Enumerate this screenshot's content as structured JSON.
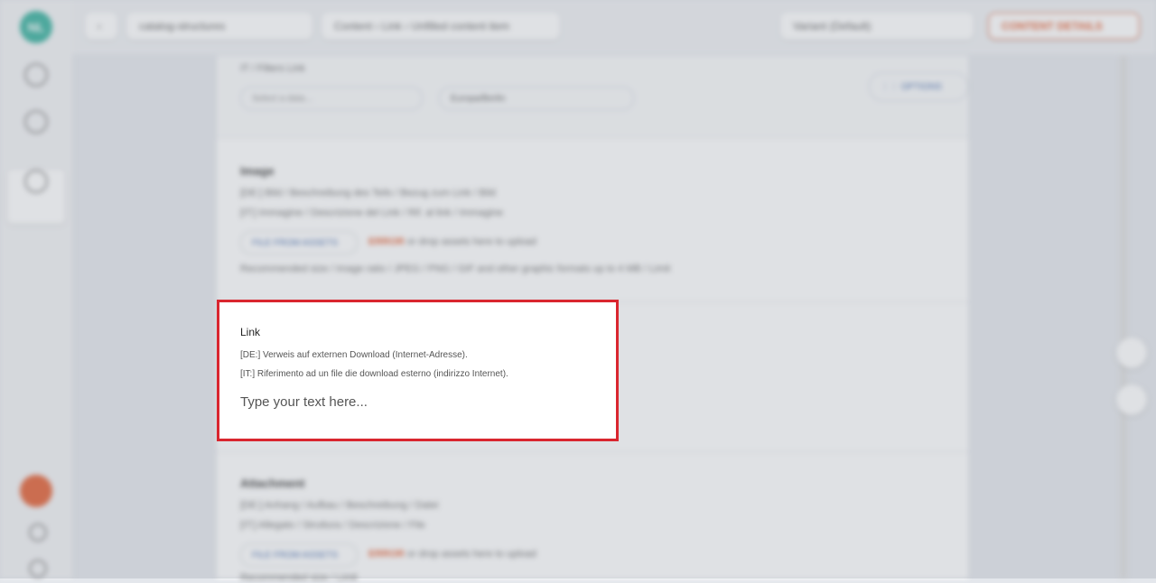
{
  "background": {
    "logo_text": "NL",
    "topbar": {
      "back": "‹",
      "selector": "catalog-structures",
      "breadcrumb": [
        "Content",
        "Link",
        "Unfilled content item"
      ],
      "variant": "Variant (Default)",
      "action": "CONTENT DETAILS"
    },
    "filters": {
      "label": "IT / Filters Link",
      "search_placeholder": "Select a data…",
      "dropdown": "Europa/Berlin",
      "options_btn": "⋮⋮ OPTIONS"
    },
    "image_section": {
      "title": "Image",
      "de": "[DE:] Bild / Beschreibung des Teils / Bezug zum Link / Bild",
      "it": "[IT:] Immagine / Descrizione del Link / Rif. al link / Immagine",
      "chip": "FILE FROM ASSETS",
      "drop": "ERROR",
      "drop_rest": "or drop assets here to upload",
      "hint": "Recommended size / image ratio / JPEG / PNG / GIF and other graphic formats up to 4 MB / Limit"
    },
    "attachment_section": {
      "title": "Attachment",
      "de": "[DE:] Anhang / Aufbau / Beschreibung / Datei",
      "it": "[IT:] Allegato / Struttura / Descrizione / File",
      "chip": "FILE FROM ASSETS",
      "drop": "ERROR",
      "drop_rest": "or drop assets here to upload",
      "hint": "Recommended size / Limit"
    }
  },
  "card": {
    "title": "Link",
    "de": "[DE:] Verweis auf externen Download (Internet-Adresse).",
    "it": "[IT:] Riferimento ad un file die download esterno (indirizzo Internet).",
    "placeholder": "Type your text here...",
    "value": ""
  },
  "colors": {
    "highlight_border": "#d9262f",
    "accent": "#2fae9a",
    "warning": "#e35a2c"
  }
}
